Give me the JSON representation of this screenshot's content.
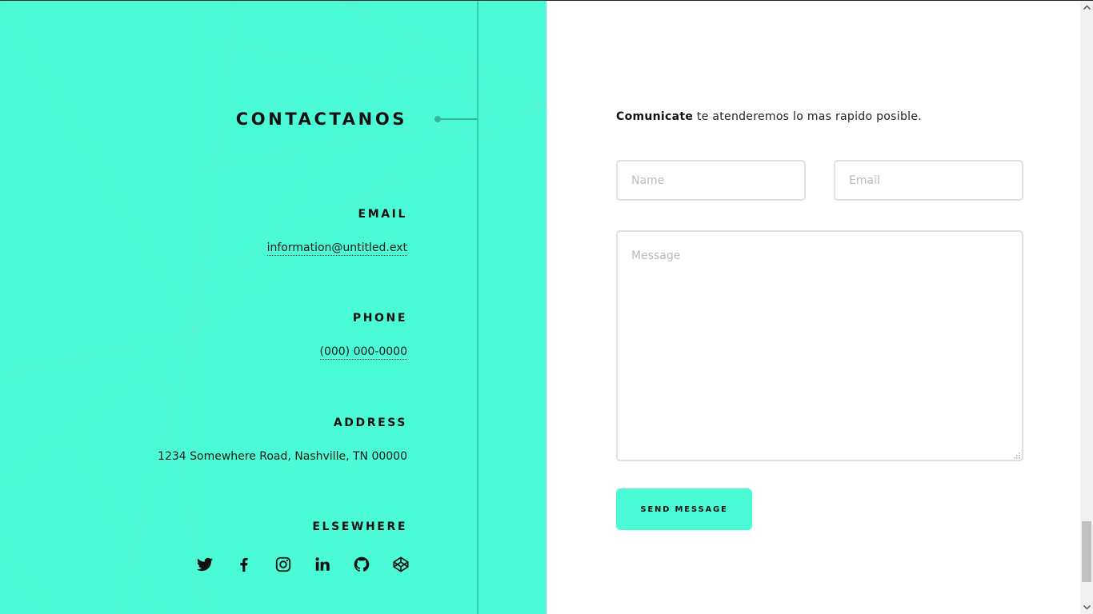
{
  "contact": {
    "title": "CONTACTANOS",
    "email": {
      "label": "EMAIL",
      "value": "information@untitled.ext"
    },
    "phone": {
      "label": "PHONE",
      "value": "(000) 000-0000"
    },
    "address": {
      "label": "ADDRESS",
      "value": "1234 Somewhere Road, Nashville, TN 00000"
    },
    "elsewhere": {
      "label": "ELSEWHERE",
      "icons": [
        "twitter-icon",
        "facebook-icon",
        "instagram-icon",
        "linkedin-icon",
        "github-icon",
        "codepen-icon"
      ]
    }
  },
  "form": {
    "intro_bold": "Comunicate",
    "intro_rest": " te atenderemos lo mas rapido posible.",
    "name_placeholder": "Name",
    "email_placeholder": "Email",
    "message_placeholder": "Message",
    "submit_label": "SEND MESSAGE"
  },
  "colors": {
    "accent": "#4bfbd6",
    "accent_line": "#36cdb0",
    "text": "#111111",
    "field_border": "#e0e0e0"
  }
}
